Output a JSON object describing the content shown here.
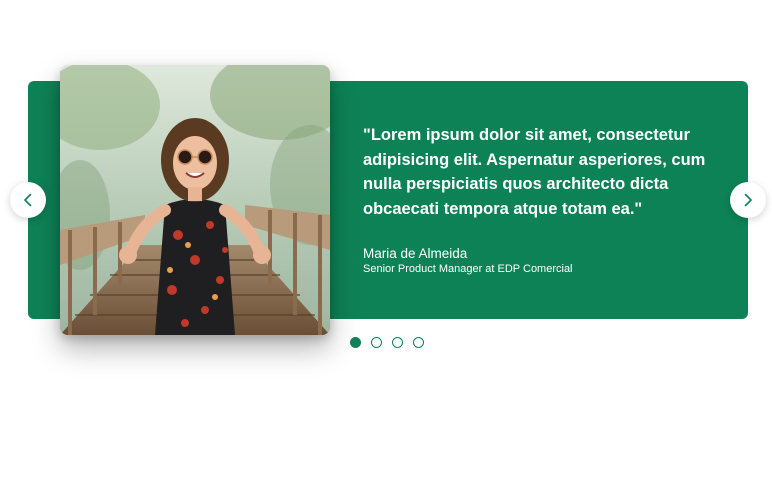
{
  "testimonial": {
    "quote": "\"Lorem ipsum dolor sit amet, consectetur adipisicing elit. Aspernatur asperiores, cum nulla perspiciatis quos architecto dicta obcaecati tempora atque totam ea.\"",
    "author_name": "Maria de Almeida",
    "author_role": "Senior Product Manager at EDP Comercial"
  },
  "navigation": {
    "prev_icon": "chevron-left-icon",
    "next_icon": "chevron-right-icon"
  },
  "pagination": {
    "total": 4,
    "active_index": 0
  },
  "colors": {
    "accent": "#0e8257",
    "background": "#ffffff",
    "text_on_accent": "#ffffff"
  }
}
